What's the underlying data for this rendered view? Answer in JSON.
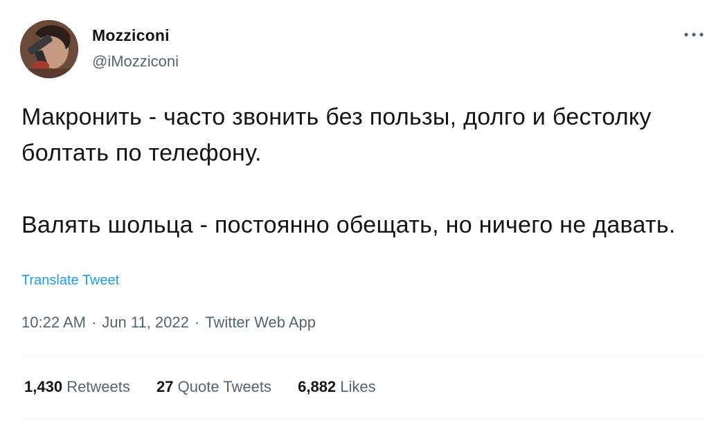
{
  "tweet": {
    "author": {
      "name": "Mozziconi",
      "handle": "@iMozziconi"
    },
    "paragraphs": [
      "Макронить - часто звонить без пользы, долго и бестолку болтать по телефону.",
      "Валять шольца - постоянно обещать, но ничего не давать."
    ],
    "translate_label": "Translate Tweet",
    "time": "10:22 AM",
    "date": "Jun 11, 2022",
    "source": "Twitter Web App",
    "separator": "·",
    "more_icon": "more-horizontal-icon",
    "stats": {
      "retweets_count": "1,430",
      "retweets_label": "Retweets",
      "quotes_count": "27",
      "quotes_label": "Quote Tweets",
      "likes_count": "6,882",
      "likes_label": "Likes"
    }
  },
  "colors": {
    "text": "#0f1419",
    "secondary": "#536471",
    "link": "#1d9bf0",
    "divider": "#eff3f4"
  }
}
